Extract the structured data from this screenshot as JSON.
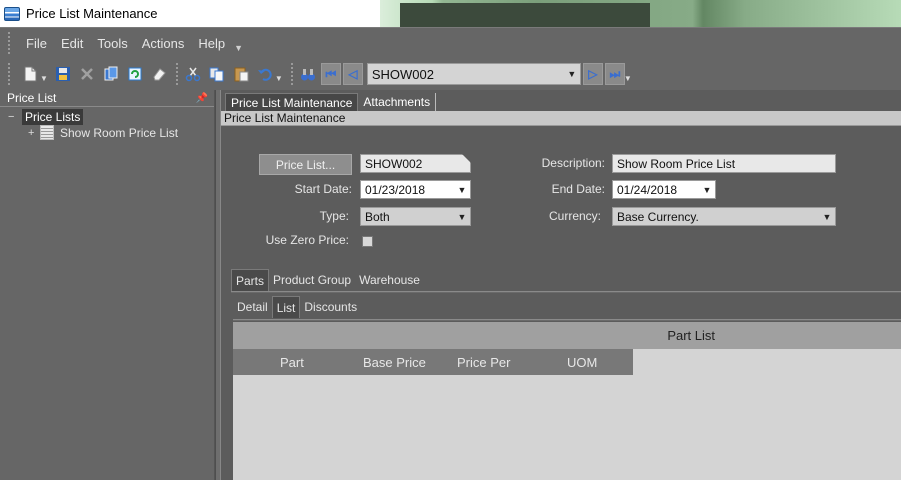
{
  "window": {
    "title": "Price List Maintenance",
    "icon": "app-database-icon"
  },
  "menu": {
    "items": [
      "File",
      "Edit",
      "Tools",
      "Actions",
      "Help"
    ]
  },
  "toolbar": {
    "icons": [
      "new-doc-icon",
      "save-icon",
      "delete-icon",
      "copy-icon",
      "refresh-icon",
      "clear-icon",
      "cut-icon",
      "copy-clipboard-icon",
      "paste-icon",
      "undo-icon",
      "binoculars-icon"
    ],
    "record_value": "SHOW002"
  },
  "left_panel": {
    "header": "Price List",
    "root": {
      "toggle": "−",
      "label": "Price Lists"
    },
    "child": {
      "toggle": "+",
      "label": "Show Room Price List"
    }
  },
  "doc_tabs": [
    "Price List Maintenance",
    "Attachments"
  ],
  "section_title": "Price List Maintenance",
  "form": {
    "price_list_button": "Price List...",
    "price_list_value": "SHOW002",
    "description_label": "Description:",
    "description_value": "Show Room Price List",
    "start_date_label": "Start Date:",
    "start_date_value": "01/23/2018",
    "end_date_label": "End Date:",
    "end_date_value": "01/24/2018",
    "type_label": "Type:",
    "type_value": "Both",
    "currency_label": "Currency:",
    "currency_value": "Base Currency.",
    "use_zero_price_label": "Use Zero Price:",
    "use_zero_price_checked": false
  },
  "tabs_level2": [
    "Parts",
    "Product Group",
    "Warehouse"
  ],
  "tabs_level3": [
    "Detail",
    "List",
    "Discounts"
  ],
  "grid": {
    "title": "Part List",
    "columns": [
      "Part",
      "Base Price",
      "Price Per",
      "UOM"
    ]
  }
}
